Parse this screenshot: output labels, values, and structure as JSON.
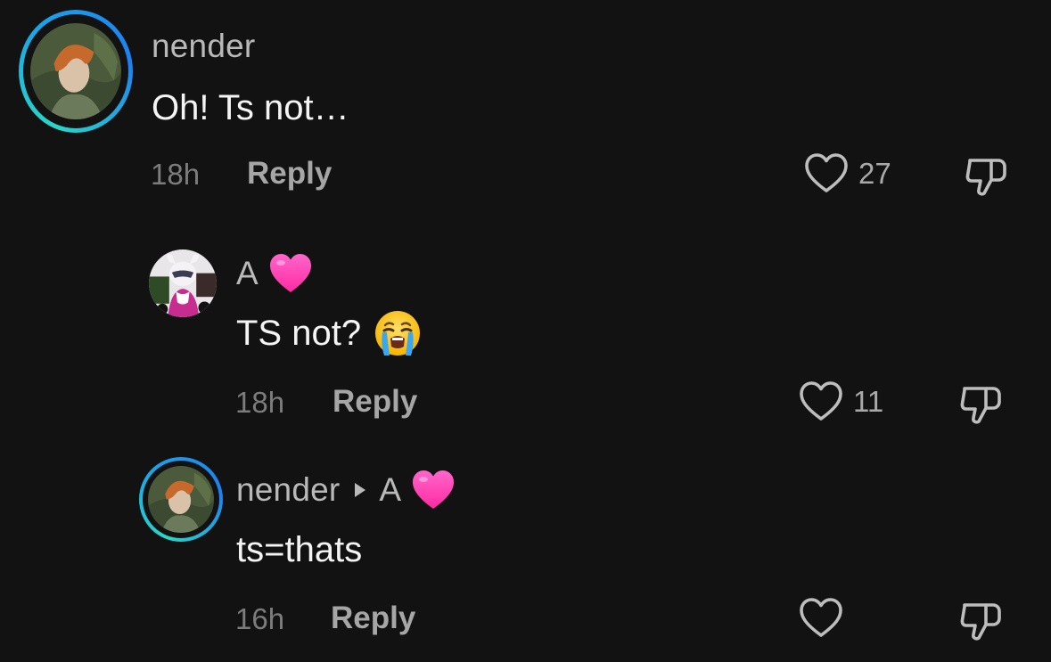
{
  "comments": [
    {
      "username": "nender",
      "text": "Oh! Ts not…",
      "time": "18h",
      "reply_label": "Reply",
      "likes": "27"
    },
    {
      "username": "A",
      "text": "TS not?",
      "time": "18h",
      "reply_label": "Reply",
      "likes": "11"
    },
    {
      "username": "nender",
      "reply_to": "A",
      "text": "ts=thats",
      "time": "16h",
      "reply_label": "Reply",
      "likes": ""
    }
  ],
  "icons": {
    "heart_emoji": "pink-heart-emoji",
    "crying_emoji": "loudly-crying-face-emoji",
    "like": "heart-outline-icon",
    "dislike": "thumbs-down-icon",
    "reply_arrow": "triangle-right-icon"
  },
  "colors": {
    "background": "#121212",
    "story_ring_start": "#2bd6c6",
    "story_ring_end": "#1f7ff0",
    "heart_pink": "#ff3fb4"
  }
}
